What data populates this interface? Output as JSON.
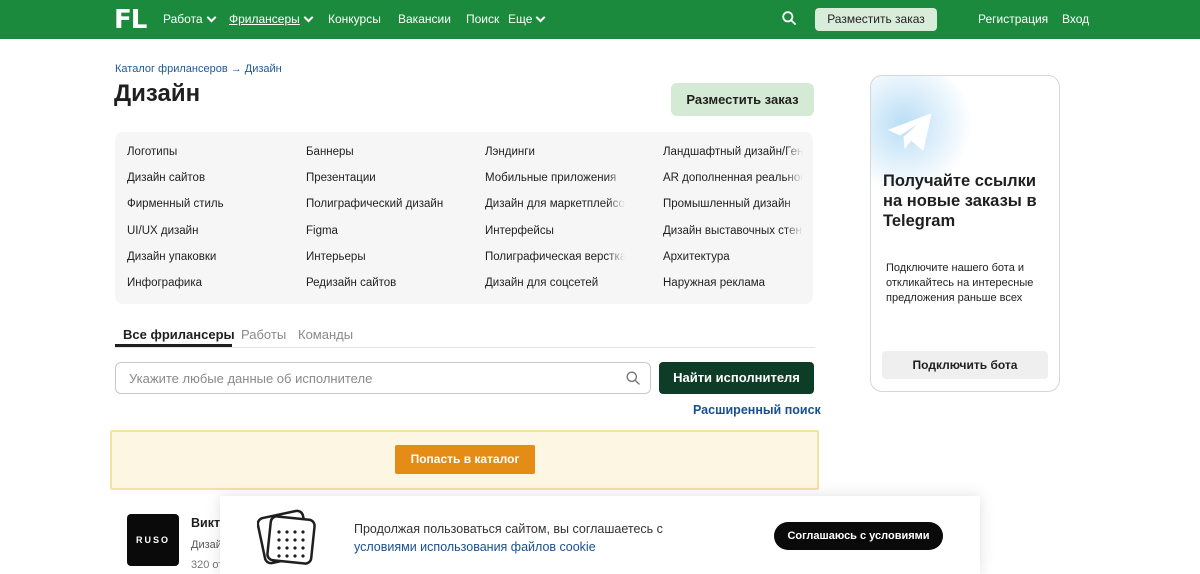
{
  "header": {
    "logo": "FL",
    "nav": [
      {
        "label": "Работа",
        "dropdown": true
      },
      {
        "label": "Фрилансеры",
        "dropdown": true
      },
      {
        "label": "Конкурсы",
        "dropdown": false
      },
      {
        "label": "Вакансии",
        "dropdown": false
      },
      {
        "label": "Поиск",
        "dropdown": false
      },
      {
        "label": "Еще",
        "dropdown": true
      }
    ],
    "order_button": "Разместить заказ",
    "register": "Регистрация",
    "login": "Вход"
  },
  "breadcrumb": "Каталог фрилансеров → Дизайн",
  "page_title": "Дизайн",
  "order_button": "Разместить заказ",
  "categories": [
    [
      "Логотипы",
      "Дизайн сайтов",
      "Фирменный стиль",
      "UI/UX дизайн",
      "Дизайн упаковки",
      "Инфографика"
    ],
    [
      "Баннеры",
      "Презентации",
      "Полиграфический дизайн",
      "Figma",
      "Интерьеры",
      "Редизайн сайтов"
    ],
    [
      "Лэндинги",
      "Мобильные приложения",
      "Дизайн для маркетплейсов",
      "Интерфейсы",
      "Полиграфическая верстка",
      "Дизайн для соцсетей"
    ],
    [
      "Ландшафтный дизайн/Генплан",
      "AR дополненная реальность",
      "Промышленный дизайн",
      "Дизайн выставочных стендов",
      "Архитектура",
      "Наружная реклама"
    ]
  ],
  "tabs": [
    "Все фрилансеры",
    "Работы",
    "Команды"
  ],
  "search": {
    "placeholder": "Укажите любые данные об исполнителе",
    "button": "Найти исполнителя",
    "advanced": "Расширенный поиск"
  },
  "catalog_button": "Попасть в каталог",
  "freelancer": {
    "logo_text": "RUSO",
    "name": "Викт",
    "spec": "Дизай",
    "reviews": "320 от"
  },
  "telegram": {
    "title": "Получайте ссылки на новые заказы в Telegram",
    "description": "Подключите нашего бота и откликайтесь на интересные предложения раньше всех",
    "button": "Подключить бота"
  },
  "cookie": {
    "text": "Продолжая пользоваться сайтом, вы соглашаетесь с",
    "link": "условиями использования файлов cookie",
    "button": "Соглашаюсь с условиями"
  },
  "colors": {
    "header_bg": "#1b8a3c",
    "primary_dark": "#0e3d27",
    "accent_orange": "#e58c17",
    "link": "#1a4f8f"
  }
}
